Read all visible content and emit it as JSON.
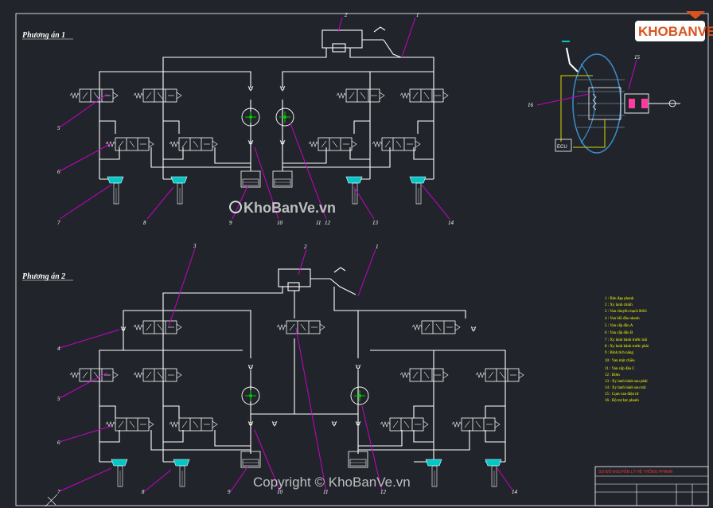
{
  "drawing": {
    "variant1_title": "Phương án 1",
    "variant2_title": "Phương án 2",
    "ecu_label": "ECU"
  },
  "callouts": {
    "v1": [
      "2",
      "1",
      "5",
      "6",
      "7",
      "8",
      "9",
      "10",
      "11",
      "12",
      "13",
      "14"
    ],
    "v2": [
      "3",
      "2",
      "1",
      "4",
      "5",
      "6",
      "7",
      "8",
      "9",
      "10",
      "11",
      "12",
      "14"
    ],
    "booster": [
      "15",
      "16"
    ]
  },
  "legend": [
    "1 : Bàn đạp phanh",
    "2 : Xy lanh chính",
    "3 : Van chuyển mạch BAS",
    "4 : Van hồi dầu nhanh",
    "5 : Van cấp dầu A",
    "6 : Van cấp dầu B",
    "7 : Xy lanh bánh trước trái",
    "8 : Xy lanh bánh trước phải",
    "9 : Bình tích năng",
    "10 : Van một chiều",
    "11 : Van cấp dầu C",
    "12 : Bơm",
    "13 : Xy lanh bánh sau phải",
    "14 : Xy lanh bánh sau trái",
    "15 : Cụm van điện từ",
    "16 : Bộ trợ lực phanh"
  ],
  "watermarks": {
    "center": "KhoBanVe.vn",
    "bottom": "Copyright © KhoBanVe.vn",
    "logo": "KHOBANVE"
  },
  "title_block": {
    "heading": "SƠ ĐỒ NGUYÊN LÝ HỆ THỐNG PHANH"
  },
  "colors": {
    "background": "#21252b",
    "lines": "#ffffff",
    "leaders": "#c800c8",
    "pump": "#00c800",
    "wheel_cyl": "#00c8c8",
    "legend": "#ffff00",
    "logo": "#d9531e"
  }
}
